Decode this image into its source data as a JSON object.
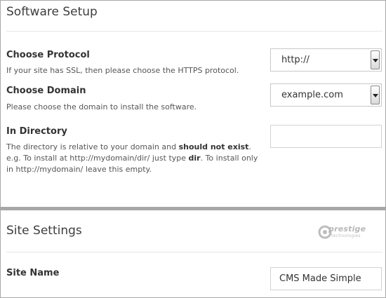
{
  "software_setup": {
    "title": "Software Setup",
    "protocol": {
      "label": "Choose Protocol",
      "help": "If your site has SSL, then please choose the HTTPS protocol.",
      "selected": "http://"
    },
    "domain": {
      "label": "Choose Domain",
      "help": "Please choose the domain to install the software.",
      "selected": "example.com"
    },
    "directory": {
      "label": "In Directory",
      "help_part1": "The directory is relative to your domain and ",
      "help_bold1": "should not exist",
      "help_part2": ". e.g. To install at http://mydomain/dir/ just type ",
      "help_bold2": "dir",
      "help_part3": ". To install only in http://mydomain/ leave this empty.",
      "value": ""
    }
  },
  "site_settings": {
    "title": "Site Settings",
    "logo": {
      "brand": "prestige",
      "sub": "technologies"
    },
    "site_name": {
      "label": "Site Name",
      "value": "CMS Made Simple"
    }
  },
  "colors": {
    "divider": "#a7a7a7",
    "border": "#a8a8a8",
    "logo_gray": "#b8b8b8"
  }
}
